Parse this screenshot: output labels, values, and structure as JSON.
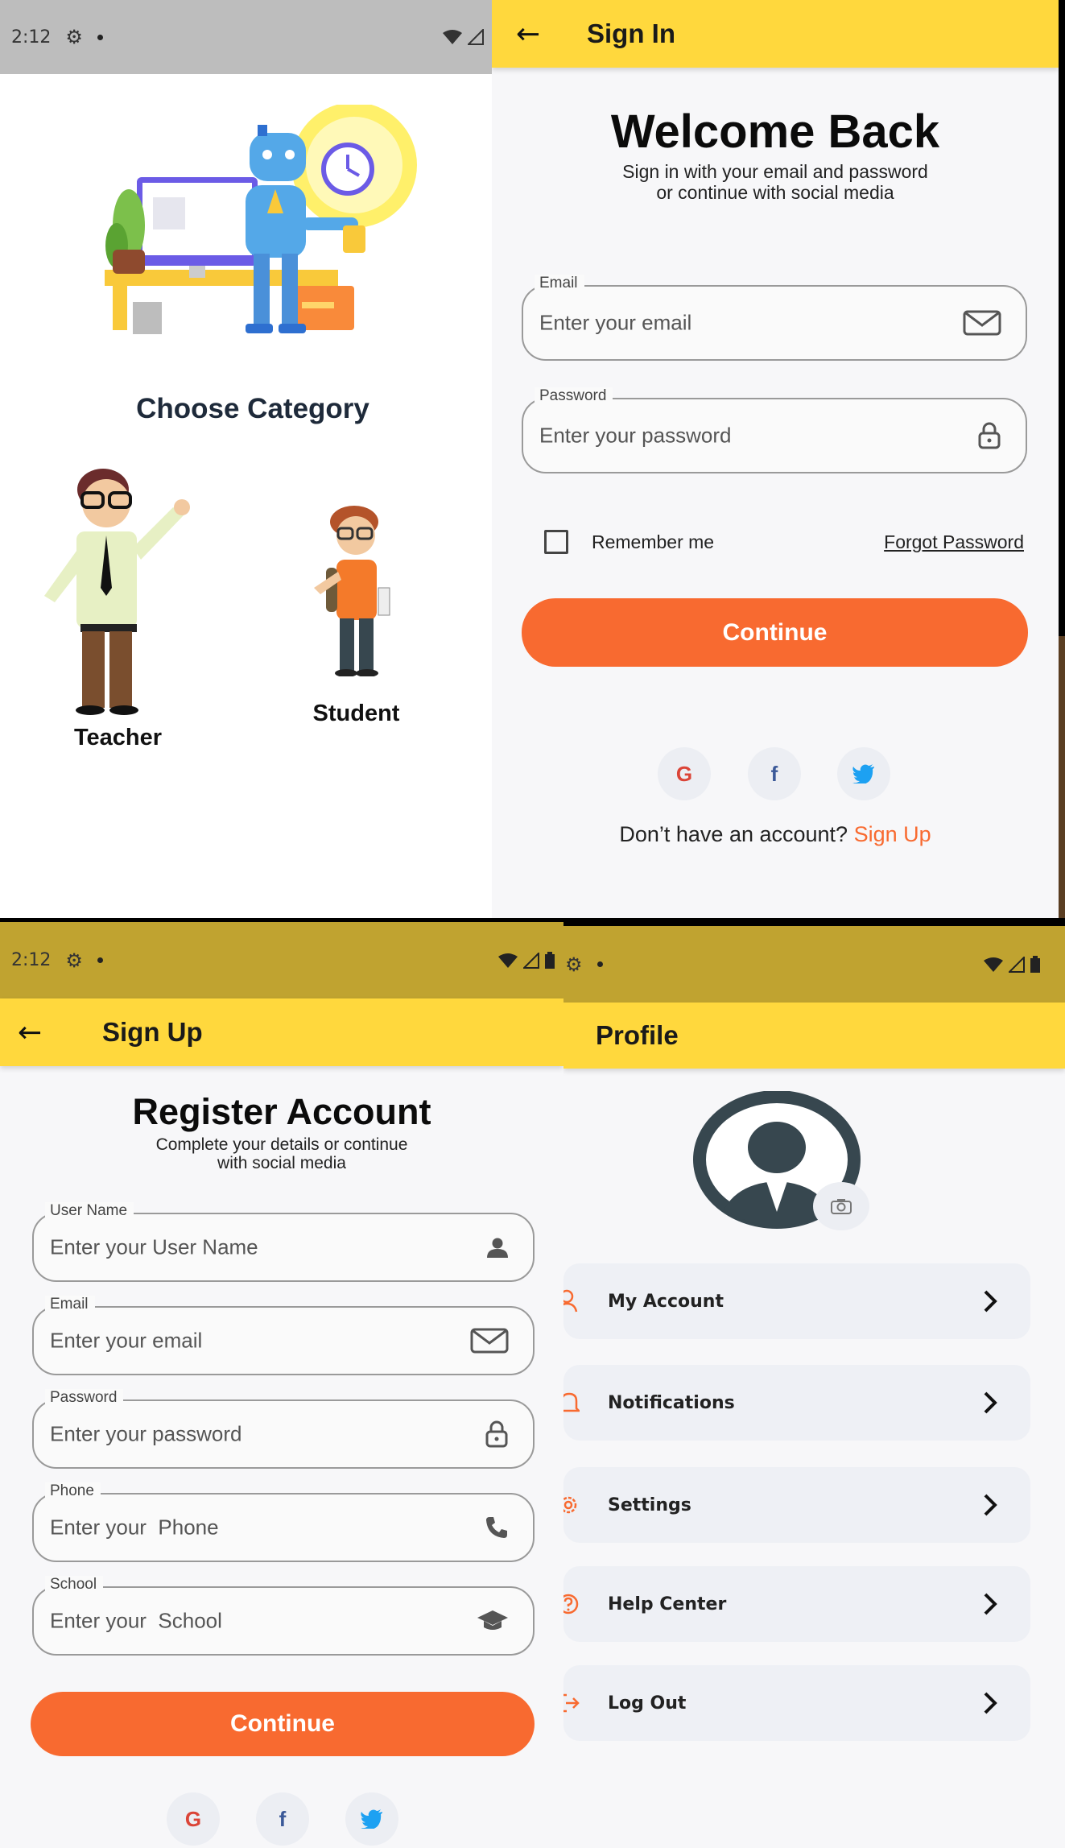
{
  "category_screen": {
    "status_time": "2:12",
    "heading": "Choose Category",
    "teacher_label": "Teacher",
    "student_label": "Student"
  },
  "signin_screen": {
    "appbar_title": "Sign In",
    "heading": "Welcome Back",
    "subtitle_line1": "Sign in with your email and password",
    "subtitle_line2": "or continue with social media",
    "email_label": "Email",
    "email_placeholder": "Enter your email",
    "password_label": "Password",
    "password_placeholder": "Enter your password",
    "remember_label": "Remember me",
    "forgot_label": "Forgot Password",
    "continue_label": "Continue",
    "no_account_text": "Don’t have an account?",
    "signup_link": "Sign Up",
    "social_icons": [
      "google-icon",
      "facebook-icon",
      "twitter-icon"
    ]
  },
  "signup_screen": {
    "status_time": "2:12",
    "appbar_title": "Sign Up",
    "heading": "Register Account",
    "subtitle_line1": "Complete your details or continue",
    "subtitle_line2": "with social media",
    "fields": [
      {
        "label": "User Name",
        "placeholder": "Enter your User Name",
        "icon": "user-icon"
      },
      {
        "label": "Email",
        "placeholder": "Enter your email",
        "icon": "mail-icon"
      },
      {
        "label": "Password",
        "placeholder": "Enter your password",
        "icon": "lock-icon"
      },
      {
        "label": "Phone",
        "placeholder": "Enter your  Phone",
        "icon": "phone-icon"
      },
      {
        "label": "School",
        "placeholder": "Enter your  School",
        "icon": "graduation-cap-icon"
      }
    ],
    "continue_label": "Continue"
  },
  "profile_screen": {
    "appbar_title": "Profile",
    "menu": [
      {
        "label": "My Account",
        "icon": "user-outline-icon"
      },
      {
        "label": "Notifications",
        "icon": "bell-icon"
      },
      {
        "label": "Settings",
        "icon": "gear-icon"
      },
      {
        "label": "Help Center",
        "icon": "help-circle-icon"
      },
      {
        "label": "Log Out",
        "icon": "logout-icon"
      }
    ]
  },
  "colors": {
    "accent_yellow": "#FFD83D",
    "primary_orange": "#F86A30",
    "status_gray": "#BDBDBD",
    "status_olive": "#C0A330"
  }
}
